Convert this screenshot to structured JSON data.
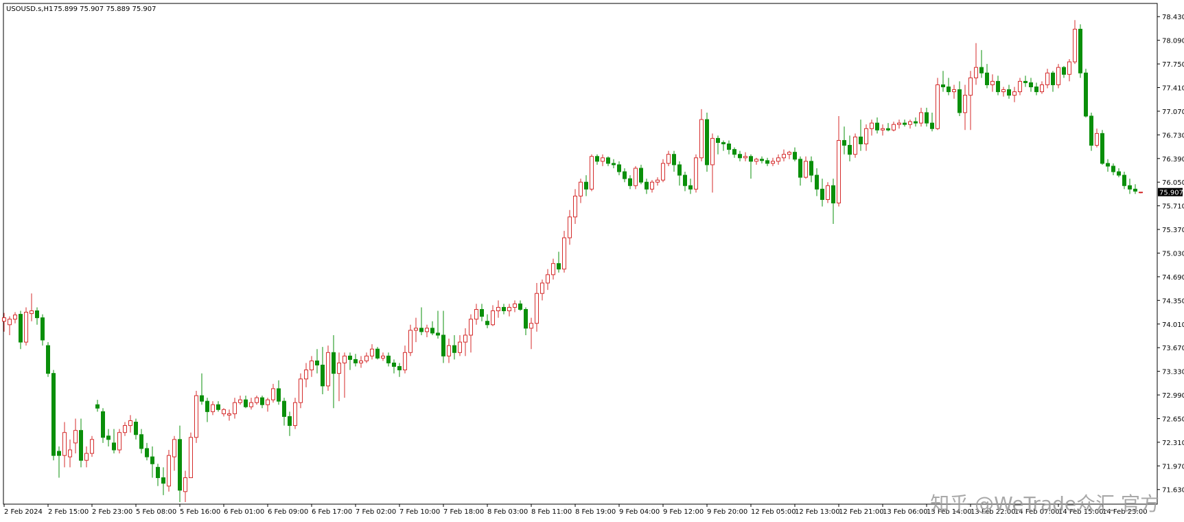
{
  "header": {
    "symbol": "USOUSD.s,H1",
    "ohlc": "75.899 75.907 75.889 75.907"
  },
  "watermark": "知乎 @WeTrade众汇 官方",
  "colors": {
    "bull": "#d42a2a",
    "bear": "#0a8f0a",
    "frame": "#000000",
    "axis_text": "#000000",
    "price_tag_bg": "#000000",
    "price_tag_text": "#ffffff"
  },
  "chart_data": {
    "type": "candlestick",
    "title": "USOUSD.s,H1",
    "last_price": "75.907",
    "ylim": [
      71.42,
      78.62
    ],
    "y_ticks": [
      "78.430",
      "78.090",
      "77.750",
      "77.410",
      "77.070",
      "76.730",
      "76.390",
      "76.050",
      "75.710",
      "75.370",
      "75.030",
      "74.690",
      "74.350",
      "74.010",
      "73.670",
      "73.330",
      "72.990",
      "72.650",
      "72.310",
      "71.970",
      "71.630"
    ],
    "x_ticks": [
      "2 Feb 2024",
      "2 Feb 15:00",
      "2 Feb 23:00",
      "5 Feb 08:00",
      "5 Feb 16:00",
      "6 Feb 01:00",
      "6 Feb 09:00",
      "6 Feb 17:00",
      "7 Feb 02:00",
      "7 Feb 10:00",
      "7 Feb 18:00",
      "8 Feb 03:00",
      "8 Feb 11:00",
      "8 Feb 19:00",
      "9 Feb 04:00",
      "9 Feb 12:00",
      "9 Feb 20:00",
      "12 Feb 05:00",
      "12 Feb 13:00",
      "12 Feb 21:00",
      "13 Feb 06:00",
      "13 Feb 14:00",
      "13 Feb 22:00",
      "14 Feb 07:00",
      "14 Feb 15:00",
      "14 Feb 23:00"
    ],
    "x_tick_index": [
      0,
      8,
      16,
      24,
      32,
      40,
      48,
      56,
      64,
      72,
      80,
      88,
      96,
      104,
      112,
      120,
      128,
      136,
      144,
      152,
      160,
      168,
      176,
      184,
      192,
      200
    ],
    "candles": [
      [
        74.05,
        74.17,
        73.9,
        74.1
      ],
      [
        74.0,
        74.12,
        73.85,
        74.08
      ],
      [
        74.08,
        74.18,
        74.02,
        74.14
      ],
      [
        74.15,
        74.2,
        73.65,
        73.75
      ],
      [
        73.75,
        74.25,
        73.7,
        74.18
      ],
      [
        74.16,
        74.45,
        74.05,
        74.2
      ],
      [
        74.2,
        74.25,
        74.0,
        74.1
      ],
      [
        74.1,
        74.15,
        73.7,
        73.78
      ],
      [
        73.7,
        73.75,
        73.25,
        73.3
      ],
      [
        73.3,
        73.35,
        72.05,
        72.12
      ],
      [
        72.18,
        72.25,
        71.8,
        72.12
      ],
      [
        72.12,
        72.6,
        71.95,
        72.45
      ],
      [
        72.1,
        72.35,
        71.95,
        72.2
      ],
      [
        72.3,
        72.65,
        72.15,
        72.48
      ],
      [
        72.48,
        72.65,
        71.95,
        72.05
      ],
      [
        72.05,
        72.25,
        71.95,
        72.15
      ],
      [
        72.15,
        72.4,
        72.1,
        72.35
      ],
      [
        72.85,
        72.92,
        72.75,
        72.8
      ],
      [
        72.75,
        72.8,
        72.3,
        72.38
      ],
      [
        72.4,
        72.5,
        72.25,
        72.35
      ],
      [
        72.3,
        72.5,
        72.15,
        72.2
      ],
      [
        72.2,
        72.5,
        72.15,
        72.45
      ],
      [
        72.45,
        72.6,
        72.4,
        72.55
      ],
      [
        72.55,
        72.7,
        72.45,
        72.62
      ],
      [
        72.6,
        72.65,
        72.35,
        72.42
      ],
      [
        72.42,
        72.5,
        72.15,
        72.22
      ],
      [
        72.22,
        72.3,
        72.05,
        72.1
      ],
      [
        72.1,
        72.25,
        71.8,
        72.0
      ],
      [
        71.95,
        72.0,
        71.68,
        71.8
      ],
      [
        71.8,
        71.95,
        71.55,
        71.72
      ],
      [
        71.68,
        72.2,
        71.6,
        72.12
      ],
      [
        72.1,
        72.4,
        71.9,
        72.35
      ],
      [
        72.35,
        72.55,
        71.45,
        71.62
      ],
      [
        71.6,
        71.9,
        71.45,
        71.8
      ],
      [
        71.8,
        72.45,
        71.8,
        72.38
      ],
      [
        72.38,
        73.05,
        72.3,
        72.98
      ],
      [
        72.98,
        73.3,
        72.85,
        72.9
      ],
      [
        72.9,
        72.95,
        72.6,
        72.75
      ],
      [
        72.75,
        72.9,
        72.7,
        72.85
      ],
      [
        72.85,
        72.9,
        72.75,
        72.78
      ],
      [
        72.72,
        72.8,
        72.68,
        72.78
      ],
      [
        72.7,
        72.78,
        72.62,
        72.72
      ],
      [
        72.72,
        72.95,
        72.65,
        72.88
      ],
      [
        72.88,
        72.98,
        72.85,
        72.92
      ],
      [
        72.92,
        72.98,
        72.8,
        72.82
      ],
      [
        72.82,
        72.95,
        72.78,
        72.88
      ],
      [
        72.88,
        72.98,
        72.85,
        72.95
      ],
      [
        72.95,
        72.98,
        72.8,
        72.85
      ],
      [
        72.85,
        72.95,
        72.75,
        72.92
      ],
      [
        72.92,
        73.15,
        72.88,
        73.08
      ],
      [
        73.08,
        73.2,
        72.85,
        72.9
      ],
      [
        72.9,
        72.95,
        72.55,
        72.68
      ],
      [
        72.68,
        72.75,
        72.4,
        72.55
      ],
      [
        72.55,
        72.95,
        72.5,
        72.88
      ],
      [
        72.88,
        73.3,
        72.8,
        73.22
      ],
      [
        73.22,
        73.45,
        73.1,
        73.35
      ],
      [
        73.35,
        73.55,
        73.25,
        73.48
      ],
      [
        73.48,
        73.65,
        73.3,
        73.42
      ],
      [
        73.42,
        73.68,
        73.0,
        73.12
      ],
      [
        73.12,
        73.7,
        73.05,
        73.6
      ],
      [
        73.6,
        73.85,
        72.8,
        73.3
      ],
      [
        73.3,
        73.6,
        72.9,
        73.45
      ],
      [
        73.45,
        73.6,
        72.95,
        73.55
      ],
      [
        73.55,
        73.6,
        73.35,
        73.5
      ],
      [
        73.5,
        73.58,
        73.4,
        73.45
      ],
      [
        73.45,
        73.55,
        73.38,
        73.48
      ],
      [
        73.48,
        73.6,
        73.45,
        73.55
      ],
      [
        73.55,
        73.72,
        73.5,
        73.65
      ],
      [
        73.65,
        73.68,
        73.5,
        73.52
      ],
      [
        73.52,
        73.6,
        73.48,
        73.55
      ],
      [
        73.55,
        73.6,
        73.4,
        73.45
      ],
      [
        73.45,
        73.5,
        73.3,
        73.4
      ],
      [
        73.4,
        73.45,
        73.25,
        73.35
      ],
      [
        73.35,
        73.7,
        73.3,
        73.6
      ],
      [
        73.6,
        74.0,
        73.55,
        73.92
      ],
      [
        73.92,
        74.1,
        73.75,
        73.95
      ],
      [
        73.95,
        74.25,
        73.85,
        73.9
      ],
      [
        73.9,
        74.0,
        73.82,
        73.95
      ],
      [
        73.95,
        74.05,
        73.85,
        73.88
      ],
      [
        73.88,
        74.2,
        73.8,
        73.85
      ],
      [
        73.85,
        74.2,
        73.45,
        73.55
      ],
      [
        73.55,
        73.8,
        73.45,
        73.7
      ],
      [
        73.7,
        73.85,
        73.5,
        73.6
      ],
      [
        73.6,
        73.85,
        73.55,
        73.75
      ],
      [
        73.75,
        73.95,
        73.55,
        73.85
      ],
      [
        73.85,
        74.15,
        73.6,
        74.08
      ],
      [
        74.08,
        74.3,
        74.0,
        74.22
      ],
      [
        74.22,
        74.3,
        74.05,
        74.12
      ],
      [
        74.05,
        74.15,
        73.95,
        74.0
      ],
      [
        74.0,
        74.28,
        73.98,
        74.2
      ],
      [
        74.2,
        74.35,
        74.1,
        74.25
      ],
      [
        74.25,
        74.3,
        74.15,
        74.2
      ],
      [
        74.2,
        74.3,
        74.12,
        74.25
      ],
      [
        74.25,
        74.35,
        74.18,
        74.3
      ],
      [
        74.3,
        74.35,
        74.2,
        74.22
      ],
      [
        74.22,
        74.25,
        73.85,
        73.95
      ],
      [
        73.95,
        74.1,
        73.65,
        74.02
      ],
      [
        74.02,
        74.6,
        73.9,
        74.45
      ],
      [
        74.45,
        74.65,
        74.35,
        74.6
      ],
      [
        74.6,
        74.8,
        74.5,
        74.72
      ],
      [
        74.72,
        74.95,
        74.65,
        74.88
      ],
      [
        74.88,
        75.05,
        74.75,
        74.8
      ],
      [
        74.8,
        75.35,
        74.75,
        75.25
      ],
      [
        75.25,
        75.65,
        75.15,
        75.55
      ],
      [
        75.55,
        75.95,
        75.45,
        75.85
      ],
      [
        75.85,
        76.1,
        75.75,
        76.05
      ],
      [
        76.05,
        76.15,
        75.85,
        75.95
      ],
      [
        75.95,
        76.45,
        75.92,
        76.42
      ],
      [
        76.42,
        76.45,
        76.3,
        76.35
      ],
      [
        76.35,
        76.45,
        76.28,
        76.4
      ],
      [
        76.4,
        76.42,
        76.28,
        76.32
      ],
      [
        76.32,
        76.38,
        76.25,
        76.3
      ],
      [
        76.3,
        76.35,
        76.15,
        76.2
      ],
      [
        76.2,
        76.25,
        76.05,
        76.1
      ],
      [
        76.1,
        76.15,
        75.95,
        76.0
      ],
      [
        76.0,
        76.28,
        75.95,
        76.25
      ],
      [
        76.25,
        76.3,
        76.02,
        76.05
      ],
      [
        76.05,
        76.1,
        75.88,
        75.95
      ],
      [
        75.95,
        76.08,
        75.9,
        76.05
      ],
      [
        76.05,
        76.12,
        76.0,
        76.08
      ],
      [
        76.08,
        76.38,
        76.05,
        76.32
      ],
      [
        76.32,
        76.5,
        76.28,
        76.45
      ],
      [
        76.45,
        76.5,
        76.2,
        76.3
      ],
      [
        76.3,
        76.35,
        76.0,
        76.15
      ],
      [
        76.15,
        76.2,
        75.92,
        76.0
      ],
      [
        76.0,
        76.1,
        75.88,
        75.95
      ],
      [
        75.95,
        76.45,
        75.9,
        76.4
      ],
      [
        76.4,
        77.1,
        76.35,
        76.95
      ],
      [
        76.95,
        77.05,
        76.2,
        76.3
      ],
      [
        76.3,
        76.75,
        75.9,
        76.68
      ],
      [
        76.68,
        76.72,
        76.45,
        76.62
      ],
      [
        76.62,
        76.65,
        76.5,
        76.6
      ],
      [
        76.6,
        76.65,
        76.45,
        76.52
      ],
      [
        76.52,
        76.55,
        76.4,
        76.45
      ],
      [
        76.45,
        76.5,
        76.35,
        76.4
      ],
      [
        76.4,
        76.48,
        76.35,
        76.42
      ],
      [
        76.42,
        76.45,
        76.1,
        76.35
      ],
      [
        76.35,
        76.4,
        76.3,
        76.38
      ],
      [
        76.38,
        76.42,
        76.32,
        76.36
      ],
      [
        76.36,
        76.4,
        76.28,
        76.32
      ],
      [
        76.32,
        76.4,
        76.28,
        76.35
      ],
      [
        76.35,
        76.45,
        76.3,
        76.4
      ],
      [
        76.4,
        76.52,
        76.35,
        76.45
      ],
      [
        76.45,
        76.5,
        76.38,
        76.48
      ],
      [
        76.48,
        76.55,
        76.35,
        76.38
      ],
      [
        76.38,
        76.42,
        76.0,
        76.12
      ],
      [
        76.12,
        76.42,
        76.1,
        76.35
      ],
      [
        76.35,
        76.42,
        76.05,
        76.15
      ],
      [
        76.15,
        76.25,
        75.85,
        75.95
      ],
      [
        75.95,
        76.1,
        75.7,
        75.8
      ],
      [
        75.8,
        76.05,
        75.75,
        76.0
      ],
      [
        76.0,
        76.1,
        75.45,
        75.75
      ],
      [
        75.75,
        77.0,
        75.7,
        76.65
      ],
      [
        76.65,
        76.85,
        76.45,
        76.58
      ],
      [
        76.58,
        76.72,
        76.35,
        76.45
      ],
      [
        76.45,
        76.75,
        76.4,
        76.7
      ],
      [
        76.7,
        76.95,
        76.5,
        76.6
      ],
      [
        76.6,
        76.88,
        76.5,
        76.82
      ],
      [
        76.82,
        76.95,
        76.72,
        76.9
      ],
      [
        76.9,
        76.98,
        76.75,
        76.8
      ],
      [
        76.8,
        76.88,
        76.72,
        76.82
      ],
      [
        76.82,
        76.9,
        76.78,
        76.8
      ],
      [
        76.8,
        76.92,
        76.78,
        76.88
      ],
      [
        76.88,
        76.95,
        76.82,
        76.9
      ],
      [
        76.9,
        76.95,
        76.85,
        76.88
      ],
      [
        76.88,
        76.95,
        76.82,
        76.92
      ],
      [
        76.92,
        76.98,
        76.85,
        76.9
      ],
      [
        76.9,
        77.12,
        76.85,
        77.05
      ],
      [
        77.05,
        77.12,
        76.85,
        76.9
      ],
      [
        76.9,
        77.05,
        76.78,
        76.82
      ],
      [
        76.82,
        77.55,
        76.8,
        77.45
      ],
      [
        77.45,
        77.65,
        77.35,
        77.42
      ],
      [
        77.42,
        77.55,
        77.3,
        77.35
      ],
      [
        77.35,
        77.45,
        77.25,
        77.38
      ],
      [
        77.38,
        77.5,
        77.0,
        77.05
      ],
      [
        77.05,
        77.45,
        76.8,
        77.3
      ],
      [
        77.3,
        77.65,
        76.8,
        77.55
      ],
      [
        77.55,
        78.05,
        77.45,
        77.7
      ],
      [
        77.7,
        77.95,
        77.55,
        77.62
      ],
      [
        77.62,
        77.75,
        77.4,
        77.45
      ],
      [
        77.45,
        77.6,
        77.35,
        77.5
      ],
      [
        77.5,
        77.58,
        77.3,
        77.35
      ],
      [
        77.35,
        77.42,
        77.28,
        77.38
      ],
      [
        77.38,
        77.45,
        77.25,
        77.3
      ],
      [
        77.3,
        77.42,
        77.2,
        77.35
      ],
      [
        77.35,
        77.55,
        77.3,
        77.5
      ],
      [
        77.5,
        77.58,
        77.42,
        77.48
      ],
      [
        77.48,
        77.55,
        77.35,
        77.42
      ],
      [
        77.42,
        77.48,
        77.3,
        77.35
      ],
      [
        77.35,
        77.5,
        77.32,
        77.45
      ],
      [
        77.45,
        77.68,
        77.4,
        77.62
      ],
      [
        77.62,
        77.65,
        77.35,
        77.45
      ],
      [
        77.45,
        77.75,
        77.4,
        77.7
      ],
      [
        77.7,
        77.72,
        77.55,
        77.6
      ],
      [
        77.6,
        77.82,
        77.5,
        77.78
      ],
      [
        77.78,
        78.38,
        77.75,
        78.25
      ],
      [
        78.25,
        78.32,
        77.55,
        77.62
      ],
      [
        77.62,
        77.68,
        76.98,
        77.0
      ],
      [
        77.0,
        77.05,
        76.5,
        76.58
      ],
      [
        76.58,
        76.82,
        76.55,
        76.75
      ],
      [
        76.75,
        76.8,
        76.3,
        76.32
      ],
      [
        76.32,
        76.38,
        76.2,
        76.28
      ],
      [
        76.28,
        76.32,
        76.15,
        76.2
      ],
      [
        76.2,
        76.25,
        76.12,
        76.15
      ],
      [
        76.15,
        76.2,
        75.95,
        76.0
      ],
      [
        76.0,
        76.1,
        75.88,
        75.95
      ],
      [
        75.95,
        76.02,
        75.88,
        75.92
      ],
      [
        75.899,
        75.907,
        75.889,
        75.907
      ]
    ]
  }
}
